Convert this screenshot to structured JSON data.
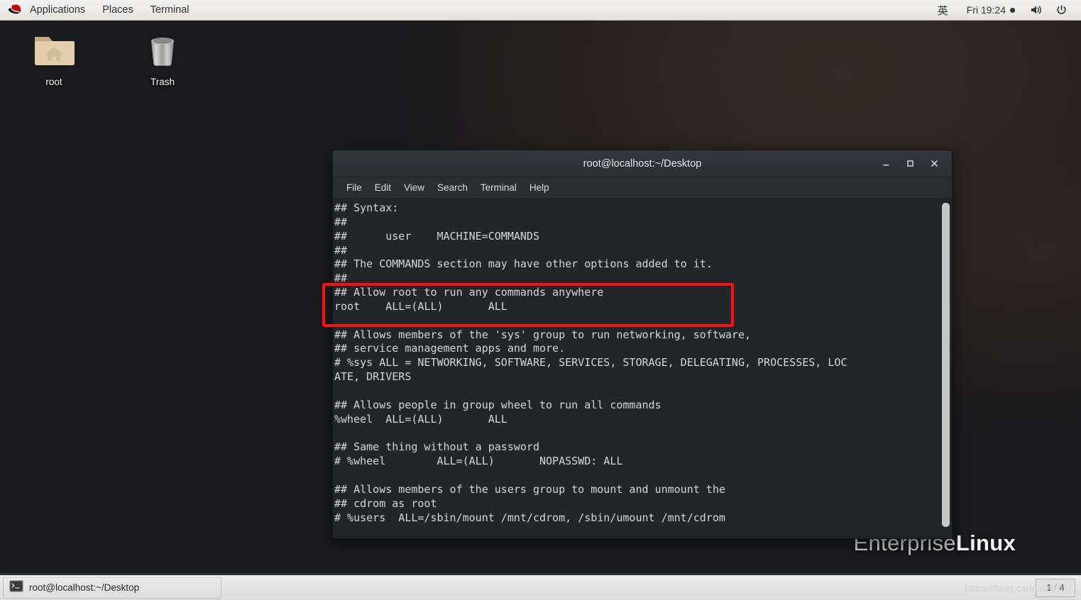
{
  "top_panel": {
    "logo": "redhat-logo",
    "menus": [
      "Applications",
      "Places",
      "Terminal"
    ],
    "input_method": "英",
    "clock": "Fri 19:24",
    "volume_icon": "volume-icon",
    "power_icon": "power-icon"
  },
  "desktop": {
    "icons": [
      {
        "label": "root",
        "icon": "home-folder-icon"
      },
      {
        "label": "Trash",
        "icon": "trash-can-icon"
      }
    ],
    "brand_light": "Enterprise",
    "brand_bold": "Linux"
  },
  "terminal": {
    "title": "root@localhost:~/Desktop",
    "menu": [
      "File",
      "Edit",
      "View",
      "Search",
      "Terminal",
      "Help"
    ],
    "window_buttons": {
      "minimize": "minimize-icon",
      "maximize": "maximize-icon",
      "close": "close-icon"
    },
    "lines": [
      "## Syntax:",
      "##",
      "##      user    MACHINE=COMMANDS",
      "##",
      "## The COMMANDS section may have other options added to it.",
      "##",
      "## Allow root to run any commands anywhere",
      "root    ALL=(ALL)       ALL",
      "",
      "## Allows members of the 'sys' group to run networking, software,",
      "## service management apps and more.",
      "# %sys ALL = NETWORKING, SOFTWARE, SERVICES, STORAGE, DELEGATING, PROCESSES, LOC",
      "ATE, DRIVERS",
      "",
      "## Allows people in group wheel to run all commands",
      "%wheel  ALL=(ALL)       ALL",
      "",
      "## Same thing without a password",
      "# %wheel        ALL=(ALL)       NOPASSWD: ALL",
      "",
      "## Allows members of the users group to mount and unmount the",
      "## cdrom as root",
      "# %users  ALL=/sbin/mount /mnt/cdrom, /sbin/umount /mnt/cdrom"
    ],
    "highlight_color": "#fa1010",
    "background_color": "#232629",
    "text_color": "#d6d6d6"
  },
  "taskbar": {
    "task_label": "root@localhost:~/Desktop",
    "task_icon": "terminal-icon",
    "watermark": "https://blog.csdn.net/S1j",
    "workspace": "1 / 4"
  }
}
